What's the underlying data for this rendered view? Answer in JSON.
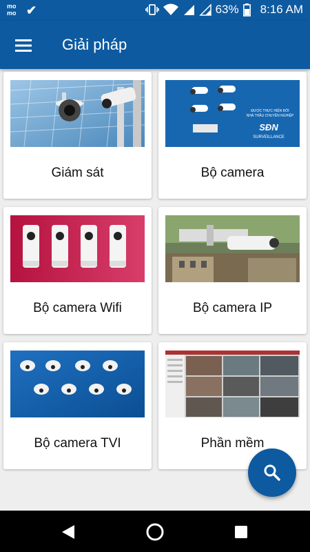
{
  "status_bar": {
    "left_app_label": "mo\nmo",
    "battery": "63%",
    "time": "8:16 AM"
  },
  "app_bar": {
    "title": "Giải pháp"
  },
  "solutions": [
    {
      "label": "Giám sát",
      "image_icon": "ptz-camera-skyscraper-image"
    },
    {
      "label": "Bộ camera",
      "image_icon": "camera-kit-image",
      "image_text": [
        "ĐƯỢC THỰC HIỆN BỞI",
        "NHÀ THẦU CHUYÊN NGHIỆP",
        "SĐN",
        "SURVEILLANCE"
      ]
    },
    {
      "label": "Bộ camera Wifi",
      "image_icon": "wifi-cameras-image"
    },
    {
      "label": "Bộ camera IP",
      "image_icon": "ip-camera-outdoor-image"
    },
    {
      "label": "Bộ camera TVI",
      "image_icon": "dome-cameras-image"
    },
    {
      "label": "Phần mềm",
      "image_icon": "software-monitor-image"
    }
  ],
  "colors": {
    "primary": "#0d5aa0",
    "background": "#eeeeee",
    "card": "#ffffff"
  }
}
